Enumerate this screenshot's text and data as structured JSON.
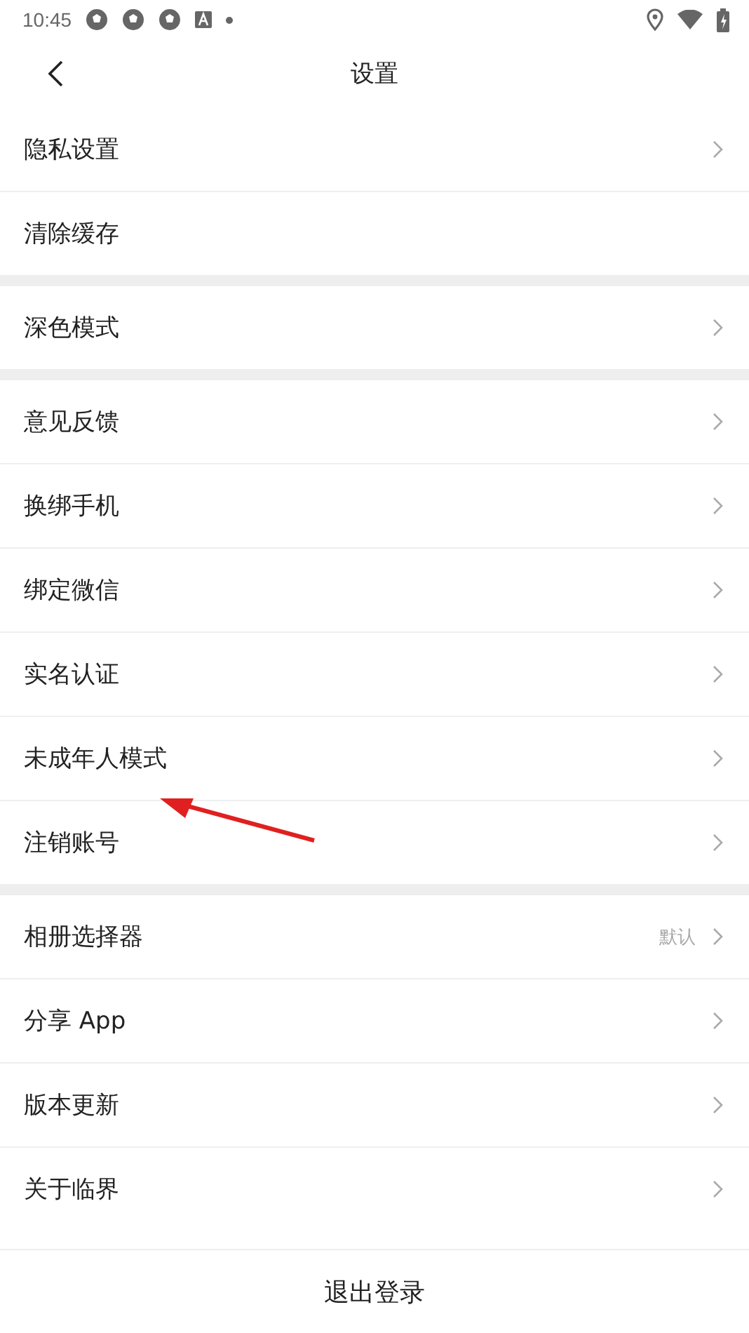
{
  "status_bar": {
    "time": "10:45"
  },
  "header": {
    "title": "设置"
  },
  "groups": [
    {
      "items": [
        {
          "label": "隐私设置",
          "kind": "link"
        },
        {
          "label": "清除缓存",
          "kind": "action"
        }
      ]
    },
    {
      "items": [
        {
          "label": "深色模式",
          "kind": "link"
        }
      ]
    },
    {
      "items": [
        {
          "label": "意见反馈",
          "kind": "link"
        },
        {
          "label": "换绑手机",
          "kind": "link"
        },
        {
          "label": "绑定微信",
          "kind": "link"
        },
        {
          "label": "实名认证",
          "kind": "link"
        },
        {
          "label": "未成年人模式",
          "kind": "link"
        },
        {
          "label": "注销账号",
          "kind": "link"
        }
      ]
    },
    {
      "items": [
        {
          "label": "相册选择器",
          "kind": "link",
          "value": "默认"
        },
        {
          "label": "分享 App",
          "kind": "link"
        },
        {
          "label": "版本更新",
          "kind": "link"
        },
        {
          "label": "关于临界",
          "kind": "link"
        }
      ]
    }
  ],
  "logout_button": {
    "label": "退出登录"
  }
}
